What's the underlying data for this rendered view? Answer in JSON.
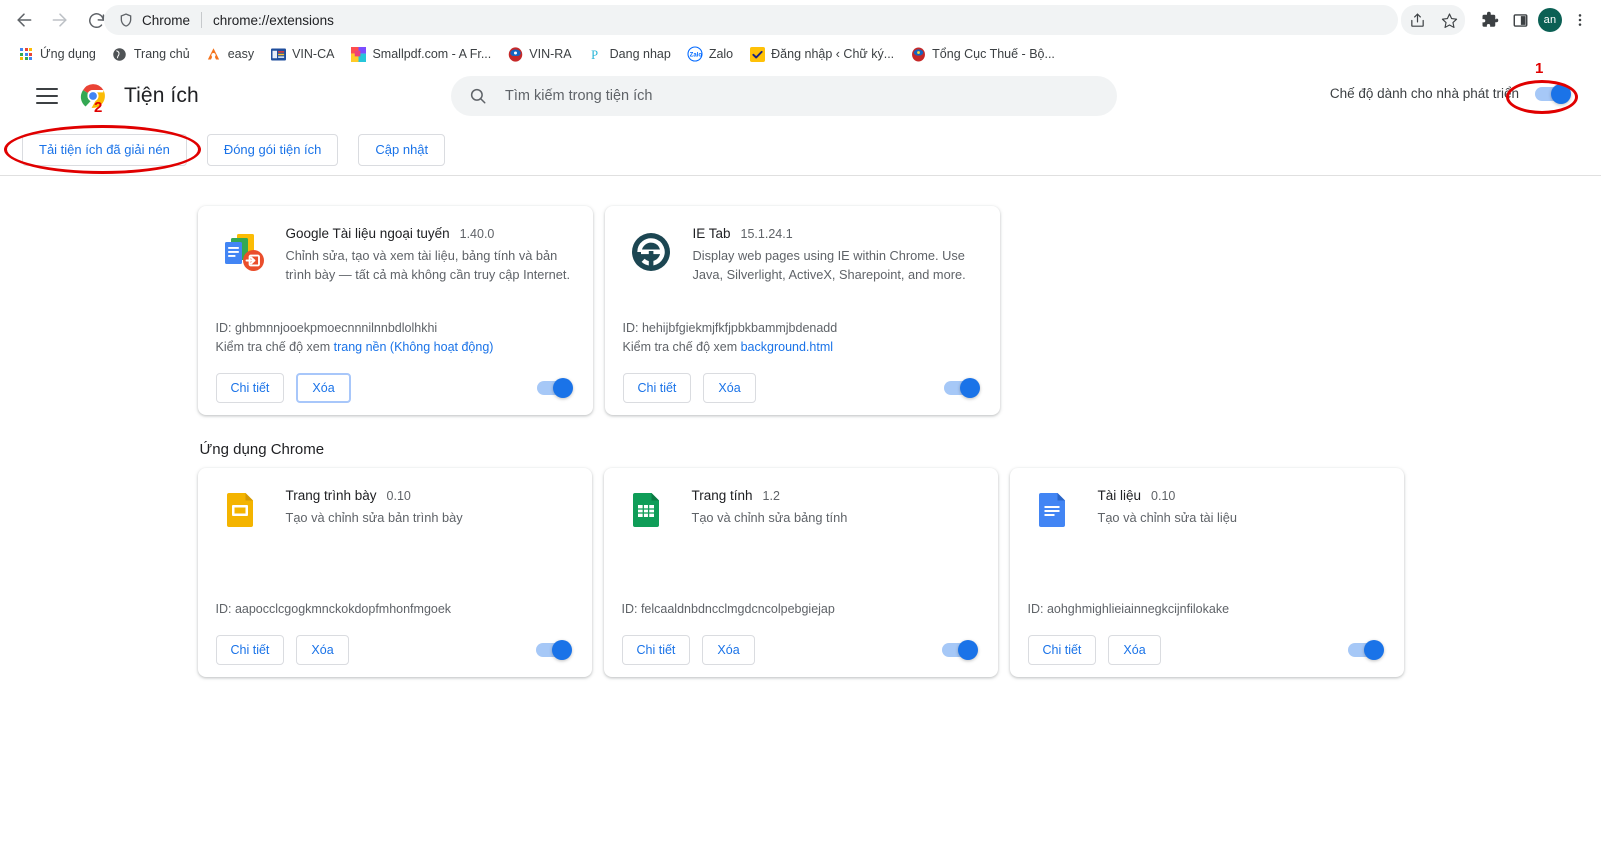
{
  "browser": {
    "nav": {
      "back": "back-arrow",
      "forward": "forward-arrow",
      "reload": "reload"
    },
    "omnibox": {
      "scheme_label": "Chrome",
      "url": "chrome://extensions"
    },
    "toolbar_icons": [
      "share-icon",
      "star-icon",
      "extensions-puzzle-icon",
      "sidepanel-icon",
      "profile-avatar",
      "three-dot-menu-icon"
    ],
    "profile_initials": "an",
    "bookmarks": [
      {
        "label": "Ứng dụng",
        "icon": "apps-grid-icon"
      },
      {
        "label": "Trang chủ",
        "icon": "globe-icon",
        "color": "#4f5356"
      },
      {
        "label": "easy",
        "icon": "easy-icon",
        "color": "#f4731c"
      },
      {
        "label": "VIN-CA",
        "icon": "vinca-icon",
        "color": "#2b5797"
      },
      {
        "label": "Smallpdf.com - A Fr...",
        "icon": "smallpdf-icon",
        "color": "#ff4d4d"
      },
      {
        "label": "VIN-RA",
        "icon": "vinra-icon",
        "color": "#c62828"
      },
      {
        "label": "Dang nhap",
        "icon": "p-icon",
        "color": "#29b6d8"
      },
      {
        "label": "Zalo",
        "icon": "zalo-icon",
        "color": "#0068ff"
      },
      {
        "label": "Đăng nhập ‹ Chữ ký...",
        "icon": "check-badge-icon",
        "color": "#ffc107"
      },
      {
        "label": "Tổng Cục Thuế - Bộ...",
        "icon": "seal-icon",
        "color": "#c62828"
      }
    ]
  },
  "page": {
    "title": "Tiện ích",
    "menu_icon": "hamburger-menu-icon",
    "logo_icon": "chrome-logo-icon",
    "search": {
      "placeholder": "Tìm kiếm trong tiện ích",
      "value": "",
      "icon": "search-icon"
    },
    "dev_mode": {
      "label": "Chế độ dành cho nhà phát triển",
      "enabled": true,
      "accent": "#1a73e8"
    },
    "toolbar_buttons": [
      {
        "label": "Tải tiện ích đã giải nén",
        "name": "load-unpacked"
      },
      {
        "label": "Đóng gói tiện ích",
        "name": "pack-extension"
      },
      {
        "label": "Cập nhật",
        "name": "update-extensions"
      }
    ],
    "buttons": {
      "details": "Chi tiết",
      "remove": "Xóa"
    },
    "id_prefix": "ID: ",
    "inspect_prefix": "Kiểm tra chế độ xem "
  },
  "extensions": [
    {
      "name": "Google Tài liệu ngoại tuyến",
      "version": "1.40.0",
      "description": "Chỉnh sửa, tạo và xem tài liệu, bảng tính và bản trình bày — tất cả mà không cần truy cập Internet.",
      "id": "ghbmnnjooekpmoecnnnilnnbdlolhkhi",
      "inspect_link": "trang nền (Không hoạt động)",
      "enabled": true,
      "icon": "google-docs-offline-icon",
      "remove_focused": true
    },
    {
      "name": "IE Tab",
      "version": "15.1.24.1",
      "description": "Display web pages using IE within Chrome. Use Java, Silverlight, ActiveX, Sharepoint, and more.",
      "id": "hehijbfgiekmjfkfjpbkbammjbdenadd",
      "inspect_link": "background.html",
      "enabled": true,
      "icon": "ie-tab-icon",
      "remove_focused": false
    }
  ],
  "apps_section": {
    "title": "Ứng dụng Chrome",
    "apps": [
      {
        "name": "Trang trình bày",
        "version": "0.10",
        "description": "Tạo và chỉnh sửa bản trình bày",
        "id": "aapocclcgogkmnckokdopfmhonfmgoek",
        "enabled": true,
        "icon": "google-slides-icon"
      },
      {
        "name": "Trang tính",
        "version": "1.2",
        "description": "Tạo và chỉnh sửa bảng tính",
        "id": "felcaaldnbdncclmgdcncolpebgiejap",
        "enabled": true,
        "icon": "google-sheets-icon"
      },
      {
        "name": "Tài liệu",
        "version": "0.10",
        "description": "Tạo và chỉnh sửa tài liệu",
        "id": "aohghmighlieiainnegkcijnfilokake",
        "enabled": true,
        "icon": "google-docs-icon"
      }
    ]
  },
  "annotations": [
    {
      "number": "1",
      "target": "developer-mode-toggle"
    },
    {
      "number": "2",
      "target": "load-unpacked-button"
    }
  ]
}
